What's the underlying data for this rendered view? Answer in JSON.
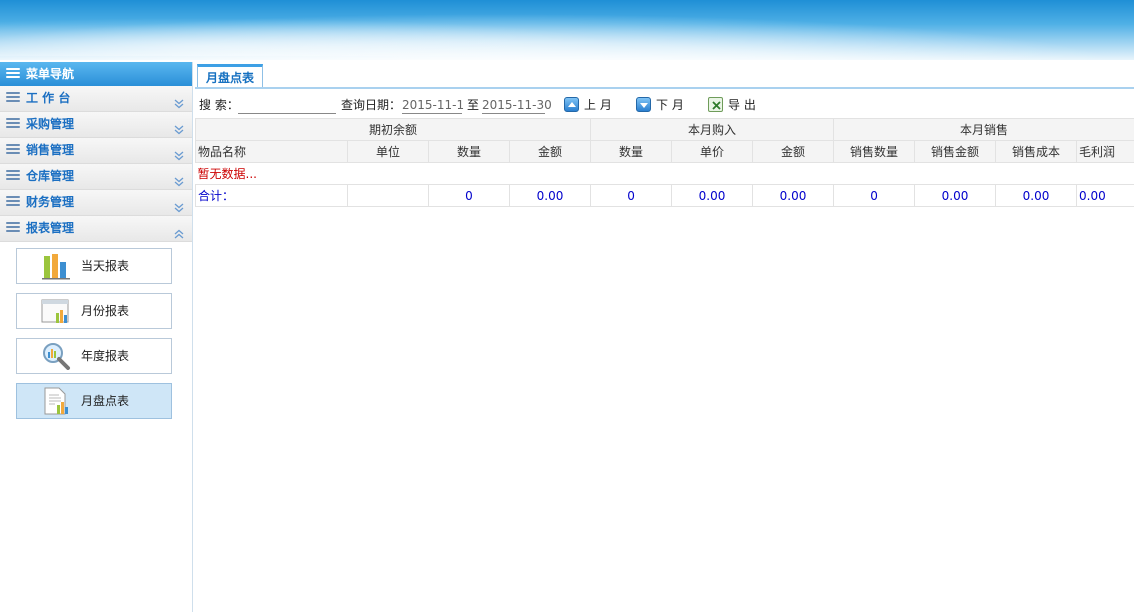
{
  "sidebar": {
    "title": "菜单导航",
    "items": [
      {
        "label": "工 作 台",
        "expanded": false
      },
      {
        "label": "采购管理",
        "expanded": false
      },
      {
        "label": "销售管理",
        "expanded": false
      },
      {
        "label": "仓库管理",
        "expanded": false
      },
      {
        "label": "财务管理",
        "expanded": false
      },
      {
        "label": "报表管理",
        "expanded": true
      }
    ],
    "subitems": [
      {
        "label": "当天报表",
        "icon": "bar-chart-icon"
      },
      {
        "label": "月份报表",
        "icon": "window-chart-icon"
      },
      {
        "label": "年度报表",
        "icon": "magnifier-icon"
      },
      {
        "label": "月盘点表",
        "icon": "document-chart-icon",
        "active": true
      }
    ]
  },
  "tab": {
    "label": "月盘点表"
  },
  "toolbar": {
    "search_label": "搜 索：",
    "search_value": "",
    "date_label": "查询日期：",
    "date_from": "2015-11-1",
    "date_sep": "至",
    "date_to": "2015-11-30",
    "prev_label": "上 月",
    "next_label": "下 月",
    "export_label": "导 出"
  },
  "table": {
    "groups": [
      "期初余额",
      "本月购入",
      "本月销售"
    ],
    "columns": [
      "物品名称",
      "单位",
      "数量",
      "金额",
      "数量",
      "单价",
      "金额",
      "销售数量",
      "销售金额",
      "销售成本",
      "毛利润"
    ],
    "no_data": "暂无数据...",
    "total_label": "合计：",
    "totals": [
      "",
      "0",
      "0.00",
      "0",
      "0.00",
      "0.00",
      "0",
      "0.00",
      "0.00",
      "0.00"
    ]
  },
  "colors": {
    "accent": "#2a8fd8",
    "link": "#1b6fc2",
    "nodata": "#cc0000",
    "number": "#0000cc"
  }
}
